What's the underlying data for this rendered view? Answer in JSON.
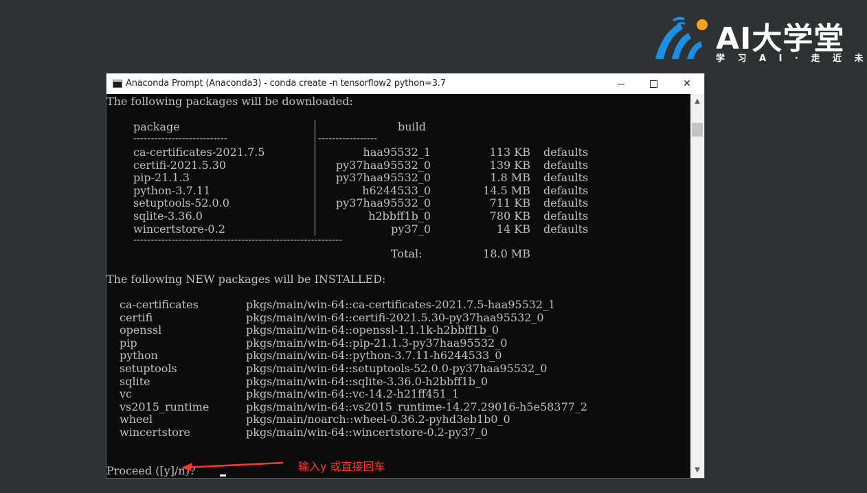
{
  "logo": {
    "title": "AI大学堂",
    "subtitle": "学 习 A I · 走 近 未 来",
    "colors": {
      "blue": "#1a8fe3",
      "orange": "#f7a21b",
      "text": "#ffffff"
    }
  },
  "window": {
    "title": "Anaconda Prompt (Anaconda3) - conda  create -n tensorflow2 python=3.7",
    "controls": {
      "minimize": "minimize-icon",
      "maximize": "maximize-icon",
      "close": "close-icon"
    }
  },
  "terminal": {
    "download_header": "The following packages will be downloaded:",
    "table_header": {
      "package": "package",
      "build": "build"
    },
    "table_rule_left": "---------------------------",
    "table_rule_right": "-----------------",
    "packages": [
      {
        "package": "ca-certificates-2021.7.5",
        "build": "haa95532_1",
        "size": "113 KB",
        "channel": "defaults"
      },
      {
        "package": "certifi-2021.5.30",
        "build": "py37haa95532_0",
        "size": "139 KB",
        "channel": "defaults"
      },
      {
        "package": "pip-21.1.3",
        "build": "py37haa95532_0",
        "size": "1.8 MB",
        "channel": "defaults"
      },
      {
        "package": "python-3.7.11",
        "build": "h6244533_0",
        "size": "14.5 MB",
        "channel": "defaults"
      },
      {
        "package": "setuptools-52.0.0",
        "build": "py37haa95532_0",
        "size": "711 KB",
        "channel": "defaults"
      },
      {
        "package": "sqlite-3.36.0",
        "build": "h2bbff1b_0",
        "size": "780 KB",
        "channel": "defaults"
      },
      {
        "package": "wincertstore-0.2",
        "build": "py37_0",
        "size": "14 KB",
        "channel": "defaults"
      }
    ],
    "total_rule": "------------------------------------------------------------",
    "total_label": "Total:",
    "total_value": "18.0 MB",
    "install_header": "The following NEW packages will be INSTALLED:",
    "installs": [
      {
        "name": "ca-certificates",
        "spec": "pkgs/main/win-64::ca-certificates-2021.7.5-haa95532_1"
      },
      {
        "name": "certifi",
        "spec": "pkgs/main/win-64::certifi-2021.5.30-py37haa95532_0"
      },
      {
        "name": "openssl",
        "spec": "pkgs/main/win-64::openssl-1.1.1k-h2bbff1b_0"
      },
      {
        "name": "pip",
        "spec": "pkgs/main/win-64::pip-21.1.3-py37haa95532_0"
      },
      {
        "name": "python",
        "spec": "pkgs/main/win-64::python-3.7.11-h6244533_0"
      },
      {
        "name": "setuptools",
        "spec": "pkgs/main/win-64::setuptools-52.0.0-py37haa95532_0"
      },
      {
        "name": "sqlite",
        "spec": "pkgs/main/win-64::sqlite-3.36.0-h2bbff1b_0"
      },
      {
        "name": "vc",
        "spec": "pkgs/main/win-64::vc-14.2-h21ff451_1"
      },
      {
        "name": "vs2015_runtime",
        "spec": "pkgs/main/win-64::vs2015_runtime-14.27.29016-h5e58377_2"
      },
      {
        "name": "wheel",
        "spec": "pkgs/main/noarch::wheel-0.36.2-pyhd3eb1b0_0"
      },
      {
        "name": "wincertstore",
        "spec": "pkgs/main/win-64::wincertstore-0.2-py37_0"
      }
    ],
    "prompt": "Proceed ([y]/n)?"
  },
  "annotation": {
    "text": "输入y 或直接回车",
    "color": "#ff3b30"
  }
}
